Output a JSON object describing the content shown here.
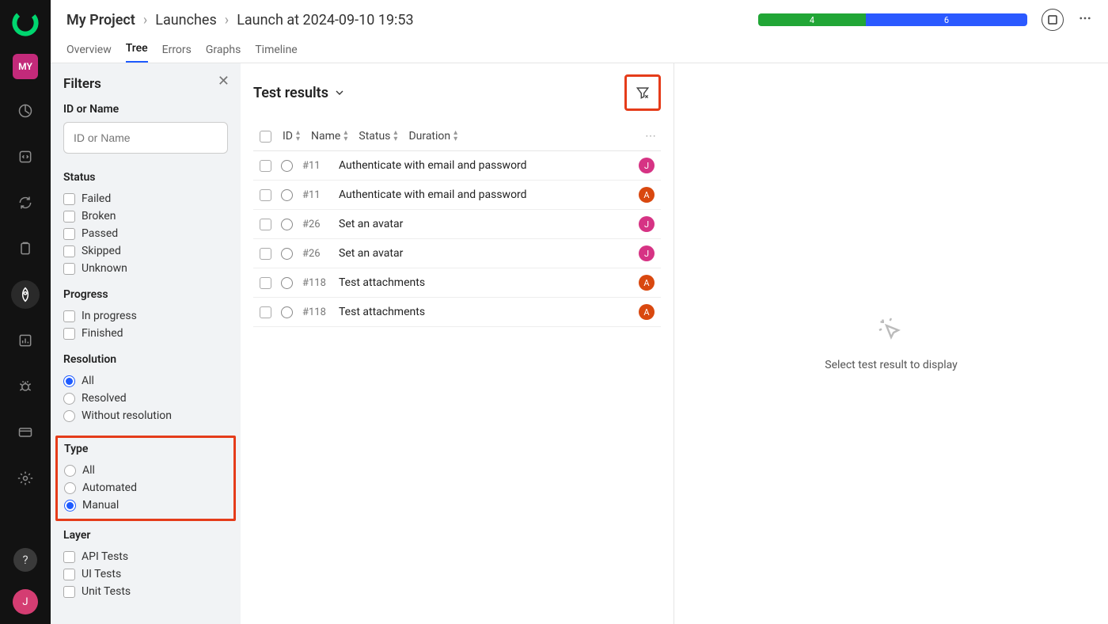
{
  "rail": {
    "project_badge": "MY",
    "user_badge": "J"
  },
  "breadcrumb": [
    "My Project",
    "Launches",
    "Launch at 2024-09-10 19:53"
  ],
  "status_bar": {
    "green": 4,
    "blue": 6
  },
  "tabs": [
    "Overview",
    "Tree",
    "Errors",
    "Graphs",
    "Timeline"
  ],
  "active_tab": "Tree",
  "filters": {
    "title": "Filters",
    "id_name_label": "ID or Name",
    "id_name_placeholder": "ID or Name",
    "status_label": "Status",
    "status_opts": [
      "Failed",
      "Broken",
      "Passed",
      "Skipped",
      "Unknown"
    ],
    "progress_label": "Progress",
    "progress_opts": [
      "In progress",
      "Finished"
    ],
    "resolution_label": "Resolution",
    "resolution_opts": [
      "All",
      "Resolved",
      "Without resolution"
    ],
    "resolution_sel": "All",
    "type_label": "Type",
    "type_opts": [
      "All",
      "Automated",
      "Manual"
    ],
    "type_sel": "Manual",
    "layer_label": "Layer",
    "layer_opts": [
      "API Tests",
      "UI Tests",
      "Unit Tests"
    ]
  },
  "results": {
    "title": "Test results",
    "columns": [
      "ID",
      "Name",
      "Status",
      "Duration"
    ],
    "rows": [
      {
        "id": "#11",
        "name": "Authenticate with email and password",
        "badge": "J",
        "color": "pink"
      },
      {
        "id": "#11",
        "name": "Authenticate with email and password",
        "badge": "A",
        "color": "red"
      },
      {
        "id": "#26",
        "name": "Set an avatar",
        "badge": "J",
        "color": "pink"
      },
      {
        "id": "#26",
        "name": "Set an avatar",
        "badge": "J",
        "color": "pink"
      },
      {
        "id": "#118",
        "name": "Test attachments",
        "badge": "A",
        "color": "red"
      },
      {
        "id": "#118",
        "name": "Test attachments",
        "badge": "A",
        "color": "red"
      }
    ]
  },
  "detail_empty": "Select test result to display"
}
